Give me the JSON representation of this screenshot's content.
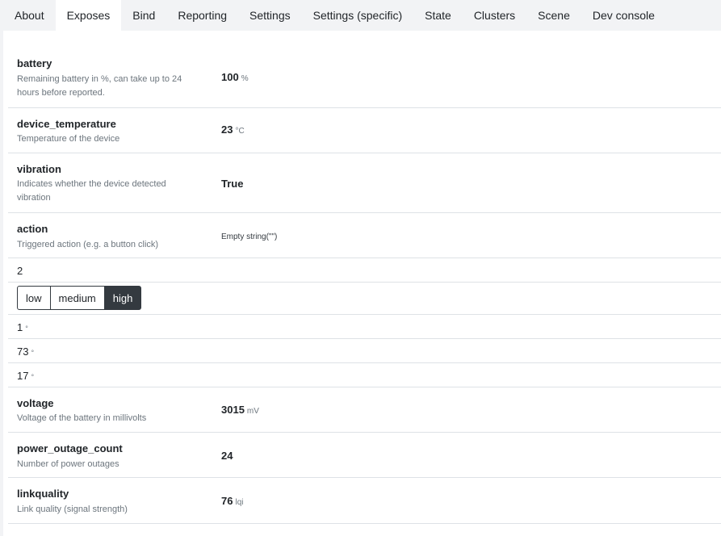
{
  "tabs": [
    "About",
    "Exposes",
    "Bind",
    "Reporting",
    "Settings",
    "Settings (specific)",
    "State",
    "Clusters",
    "Scene",
    "Dev console"
  ],
  "active_tab": "Exposes",
  "exposes": {
    "battery": {
      "name": "battery",
      "description": "Remaining battery in %, can take up to 24 hours before reported.",
      "value": "100",
      "unit": "%"
    },
    "device_temperature": {
      "name": "device_temperature",
      "description": "Temperature of the device",
      "value": "23",
      "unit": "°C"
    },
    "vibration": {
      "name": "vibration",
      "description": "Indicates whether the device detected vibration",
      "value": "True"
    },
    "action": {
      "name": "action",
      "description": "Triggered action (e.g. a button click)",
      "value": "Empty string(\"\")"
    },
    "number_value": "2",
    "sensitivity": {
      "options": [
        "low",
        "medium",
        "high"
      ],
      "selected": "high"
    },
    "angle_x": {
      "value": "1",
      "unit": "°"
    },
    "angle_y": {
      "value": "73",
      "unit": "°"
    },
    "angle_z": {
      "value": "17",
      "unit": "°"
    },
    "voltage": {
      "name": "voltage",
      "description": "Voltage of the battery in millivolts",
      "value": "3015",
      "unit": "mV"
    },
    "power_outage_count": {
      "name": "power_outage_count",
      "description": "Number of power outages",
      "value": "24"
    },
    "linkquality": {
      "name": "linkquality",
      "description": "Link quality (signal strength)",
      "value": "76",
      "unit": "lqi"
    }
  },
  "colors": {
    "active_button_bg": "#343a40",
    "border": "#dee2e6",
    "muted_text": "#6c757d"
  }
}
